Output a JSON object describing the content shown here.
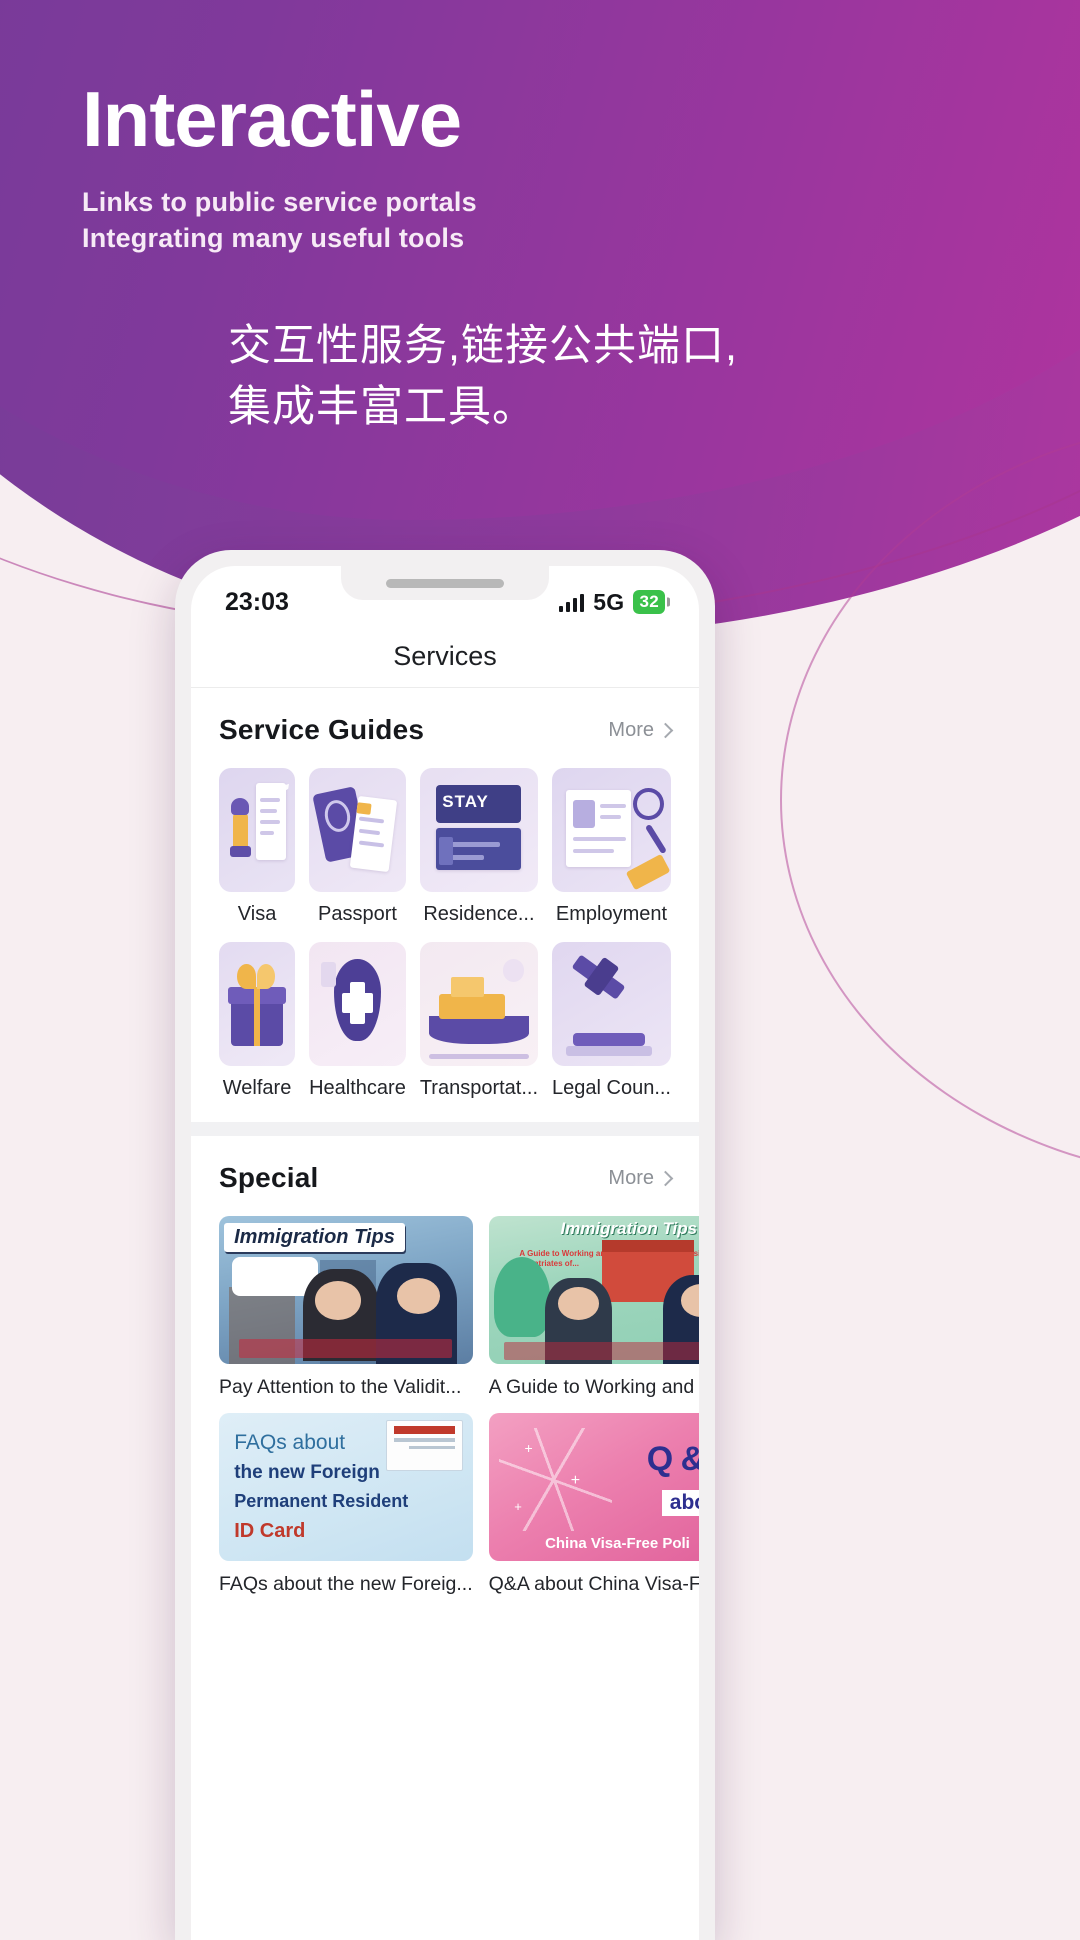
{
  "hero": {
    "title": "Interactive",
    "subtitle_line1": "Links to public service portals",
    "subtitle_line2": "Integrating many useful tools",
    "chinese_line1": "交互性服务,链接公共端口,",
    "chinese_line2": "集成丰富工具。",
    "accent_purple": "#7b3c99",
    "accent_magenta": "#bb33a0",
    "text_color": "#ffffff"
  },
  "phone": {
    "status_bar": {
      "time": "23:03",
      "network": "5G",
      "battery": "32",
      "signal_icon": "signal-bars-icon",
      "battery_color": "#3ac14a"
    },
    "navbar": {
      "title": "Services"
    }
  },
  "service_guides": {
    "title": "Service Guides",
    "more_label": "More",
    "more_icon": "chevron-right-icon",
    "items": [
      {
        "label": "Visa",
        "icon": "visa-stamp-icon"
      },
      {
        "label": "Passport",
        "icon": "passport-book-icon"
      },
      {
        "label": "Residence...",
        "icon": "residence-card-icon"
      },
      {
        "label": "Employment",
        "icon": "employment-id-icon"
      },
      {
        "label": "Welfare",
        "icon": "welfare-gift-icon"
      },
      {
        "label": "Healthcare",
        "icon": "healthcare-shield-icon"
      },
      {
        "label": "Transportat...",
        "icon": "transport-ship-icon"
      },
      {
        "label": "Legal Coun...",
        "icon": "legal-gavel-icon"
      }
    ]
  },
  "special": {
    "title": "Special",
    "more_label": "More",
    "more_icon": "chevron-right-icon",
    "cards": [
      {
        "caption": "Pay Attention to the Validit...",
        "banner_title": "Immigration Tips",
        "thumb": "immigration-tips-validity-thumb"
      },
      {
        "caption": "A Guide to Working and Livi...",
        "banner_title": "Immigration Tips",
        "banner_sub": "A Guide to Working and Living in China as Business Expatriates of...",
        "thumb": "immigration-tips-working-thumb"
      },
      {
        "caption": "FAQs about the new Foreig...",
        "banner_line1": "FAQs about",
        "banner_line2": "the new Foreign",
        "banner_line3": "Permanent Resident",
        "banner_line4": "ID Card",
        "thumb": "faqs-permanent-resident-thumb"
      },
      {
        "caption": "Q&A about China Visa-Free...",
        "banner_line1": "Q & A",
        "banner_line2": "about",
        "banner_line3": "China Visa-Free Poli",
        "thumb": "qa-visa-free-thumb"
      }
    ]
  }
}
